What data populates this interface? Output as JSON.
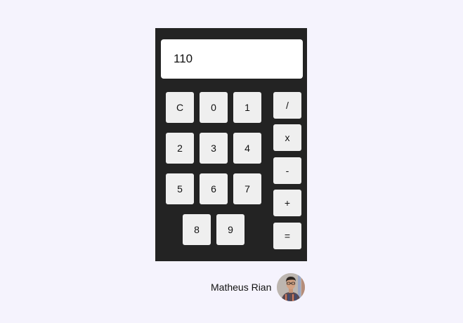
{
  "display": {
    "value": "110"
  },
  "keys": {
    "clear": "C",
    "d0": "0",
    "d1": "1",
    "d2": "2",
    "d3": "3",
    "d4": "4",
    "d5": "5",
    "d6": "6",
    "d7": "7",
    "d8": "8",
    "d9": "9"
  },
  "operators": {
    "divide": "/",
    "multiply": "x",
    "subtract": "-",
    "add": "+",
    "equals": "="
  },
  "author": {
    "name": "Matheus Rian"
  },
  "colors": {
    "page_background": "#f5f3fd",
    "calculator_body": "#232323",
    "key_background": "#efefef",
    "display_background": "#ffffff"
  }
}
